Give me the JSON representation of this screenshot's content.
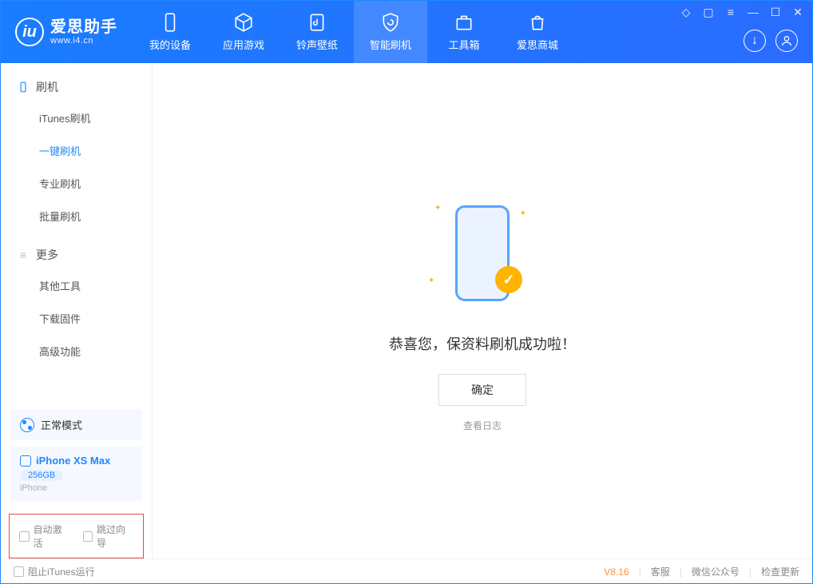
{
  "app": {
    "title": "爱思助手",
    "subtitle": "www.i4.cn"
  },
  "tabs": {
    "device": "我的设备",
    "apps": "应用游戏",
    "ringtone": "铃声壁纸",
    "flash": "智能刷机",
    "toolbox": "工具箱",
    "store": "爱思商城"
  },
  "sidebar": {
    "group1": "刷机",
    "items1": {
      "itunes": "iTunes刷机",
      "oneclick": "一键刷机",
      "pro": "专业刷机",
      "batch": "批量刷机"
    },
    "group2": "更多",
    "items2": {
      "other": "其他工具",
      "firmware": "下载固件",
      "advanced": "高级功能"
    },
    "mode": "正常模式",
    "device": {
      "name": "iPhone XS Max",
      "storage": "256GB",
      "type": "iPhone"
    },
    "cb1": "自动激活",
    "cb2": "跳过向导"
  },
  "main": {
    "message": "恭喜您，保资料刷机成功啦！",
    "ok": "确定",
    "log": "查看日志"
  },
  "footer": {
    "block_itunes": "阻止iTunes运行",
    "version": "V8.16",
    "support": "客服",
    "wechat": "微信公众号",
    "update": "检查更新"
  }
}
